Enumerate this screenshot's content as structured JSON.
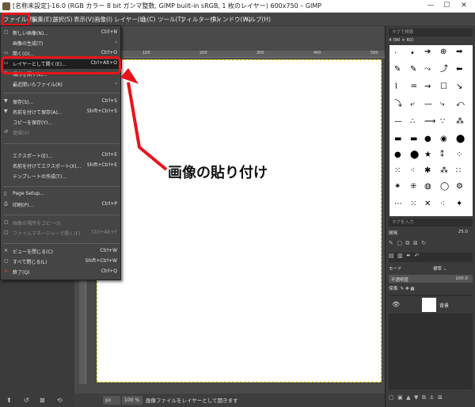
{
  "window": {
    "title": "[名称未設定]-16.0 (RGB カラー 8 bit ガンマ整数, GIMP built-in sRGB, 1 枚のレイヤー) 600x750 – GIMP",
    "minimize": "—",
    "maximize": "☐",
    "close": "✕"
  },
  "menubar": [
    "ファイル(F)",
    "編集(E)",
    "選択(S)",
    "表示(V)",
    "画像(I)",
    "レイヤー(L)",
    "色(C)",
    "ツール(T)",
    "フィルター(R)",
    "ウィンドウ(W)",
    "ヘルプ(H)"
  ],
  "file_menu": [
    {
      "label": "新しい画像(N)...",
      "shortcut": "Ctrl+N",
      "icon": "new-doc-icon"
    },
    {
      "label": "画像の生成(T)",
      "shortcut": "›",
      "icon": ""
    },
    {
      "label": "開く(O)...",
      "shortcut": "Ctrl+O",
      "icon": "open-icon"
    },
    {
      "label": "レイヤーとして開く(E)...",
      "shortcut": "Ctrl+Alt+O",
      "icon": "open-layer-icon"
    },
    {
      "label": "場所を開く(L)...",
      "shortcut": "",
      "icon": "location-icon"
    },
    {
      "label": "最近開いたファイル(R)",
      "shortcut": "›",
      "icon": ""
    },
    {
      "label": "保存(S)...",
      "shortcut": "Ctrl+S",
      "icon": "save-icon"
    },
    {
      "label": "名前を付けて保存(A)...",
      "shortcut": "Shift+Ctrl+S",
      "icon": "save-as-icon"
    },
    {
      "label": "コピーを保存(Y)...",
      "shortcut": "",
      "icon": ""
    },
    {
      "label": "復帰(V)",
      "shortcut": "",
      "icon": "revert-icon"
    },
    {
      "label": "エクスポート(E)...",
      "shortcut": "Ctrl+E",
      "icon": ""
    },
    {
      "label": "名前を付けてエクスポート(X)...",
      "shortcut": "Shift+Ctrl+E",
      "icon": ""
    },
    {
      "label": "テンプレートの作成(T)...",
      "shortcut": "",
      "icon": ""
    },
    {
      "label": "Page Setup...",
      "shortcut": "",
      "icon": "page-setup-icon"
    },
    {
      "label": "印刷(P)...",
      "shortcut": "Ctrl+P",
      "icon": "print-icon"
    },
    {
      "label": "画像の場所をコピー(I)",
      "shortcut": "",
      "icon": "copy-location-icon"
    },
    {
      "label": "ファイルマネージャーで開く(F)",
      "shortcut": "Ctrl+Alt+F",
      "icon": "file-manager-icon"
    },
    {
      "label": "ビューを閉じる(C)",
      "shortcut": "Ctrl+W",
      "icon": "close-view-icon"
    },
    {
      "label": "すべて閉じる(L)",
      "shortcut": "Shift+Ctrl+W",
      "icon": "close-all-icon"
    },
    {
      "label": "終了(Q)",
      "shortcut": "Ctrl+Q",
      "icon": "quit-icon"
    }
  ],
  "annotation": "画像の貼り付け",
  "ruler_ticks": [
    "100",
    "200",
    "300",
    "400",
    "500"
  ],
  "statusbar": {
    "unit": "px",
    "zoom": "100 %",
    "message": "画像ファイルをレイヤーとして開きます"
  },
  "dock": {
    "search_placeholder": "タグで検索",
    "brush_name": "4 (90 × 60)",
    "tag_placeholder": "タグを入力",
    "spacing_label": "間隔",
    "spacing_value": "25.0",
    "mode_label": "モード",
    "mode_value": "標準 ⌄",
    "opacity_label": "不透明度",
    "opacity_value": "100.0",
    "lock_label": "保護:",
    "layer_name": "背景"
  },
  "colors": {
    "highlight_red": "#e8141b",
    "menu_bg": "#454545",
    "canvas": "#ffffff"
  }
}
